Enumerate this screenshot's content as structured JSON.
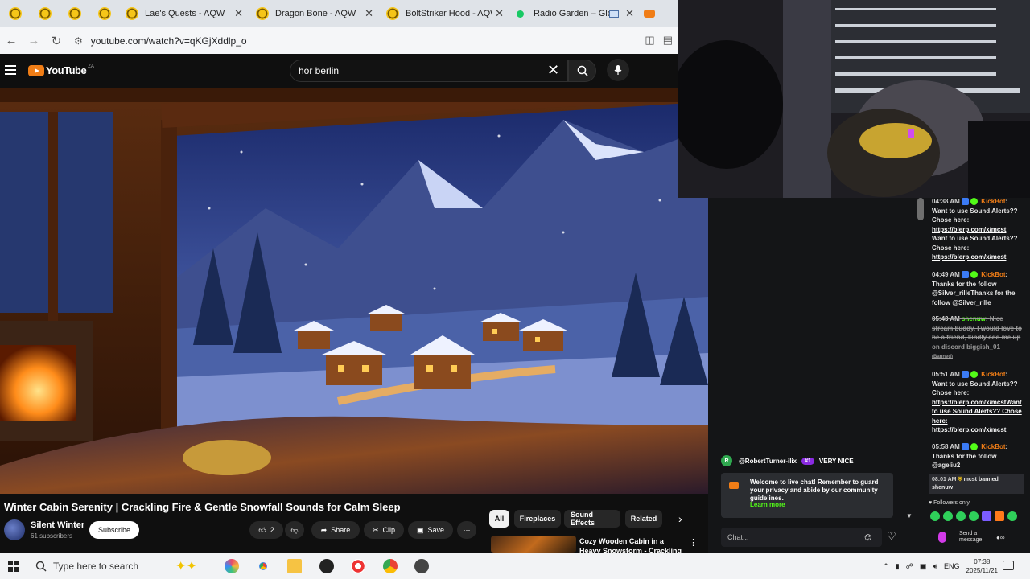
{
  "browser": {
    "tabs": [
      {
        "label": "",
        "icon": "aqw-favicon"
      },
      {
        "label": "",
        "icon": "aqw-favicon"
      },
      {
        "label": "",
        "icon": "aqw-favicon"
      },
      {
        "label": "",
        "icon": "aqw-favicon"
      },
      {
        "label": "Lae's Quests - AQW",
        "icon": "aqw-favicon"
      },
      {
        "label": "Dragon Bone - AQW",
        "icon": "aqw-favicon"
      },
      {
        "label": "BoltStriker Hood - AQW",
        "icon": "aqw-favicon"
      },
      {
        "label": "Radio Garden – Glob",
        "icon": "radio-garden-favicon"
      }
    ],
    "url": "youtube.com/watch?v=qKGjXddlp_o"
  },
  "youtube": {
    "logo_text": "YouTube",
    "logo_country": "ZA",
    "search_query": "hor berlin",
    "video_title": "Winter Cabin Serenity | Crackling Fire & Gentle Snowfall Sounds for Calm Sleep",
    "channel_name": "Silent Winter",
    "subscribers": "61 subscribers",
    "subscribe_label": "Subscribe",
    "like_count": "2",
    "share_label": "Share",
    "clip_label": "Clip",
    "save_label": "Save",
    "chips": [
      "All",
      "Fireplaces",
      "Sound Effects",
      "Related"
    ],
    "related_title": "Cozy Wooden Cabin in a Heavy Snowstorm - Crackling"
  },
  "kick": {
    "message_user": "@RobertTurner-ilix",
    "message_badge": "#1",
    "message_text": "VERY NICE",
    "welcome_text": "Welcome to live chat! Remember to guard your privacy and abide by our community guidelines.",
    "learn_more": "Learn more",
    "chat_placeholder": "Chat..."
  },
  "chat": {
    "messages": [
      {
        "time": "04:38 AM",
        "user": "KickBot",
        "text": "Want to use Sound Alerts?? Chose here:",
        "link": "https://blerp.com/x/mcst",
        "text2": "Want to use Sound Alerts?? Chose here:",
        "link2": "https://blerp.com/x/mcst"
      },
      {
        "time": "04:49 AM",
        "user": "KickBot",
        "text": "Thanks for the follow @Silver_rilleThanks for the follow @Silver_rille"
      },
      {
        "time": "05:43 AM",
        "user": "shenuw",
        "text": "Nice stream buddy, I would love to be a friend, kindly add me up on discord biggish_01",
        "banned": "(Banned)"
      },
      {
        "time": "05:51 AM",
        "user": "KickBot",
        "text": "Want to use Sound Alerts?? Chose here:",
        "link": "https://blerp.com/x/mcstWant to use Sound Alerts?? Chose here:",
        "link2": "https://blerp.com/x/mcst"
      },
      {
        "time": "05:58 AM",
        "user": "KickBot",
        "text": "Thanks for the follow @ageliu2"
      },
      {
        "time": "08:01 AM",
        "user": "mcst",
        "text": "banned shenuw"
      }
    ],
    "followers_only": "Followers only",
    "send_placeholder": "Send a message"
  },
  "taskbar": {
    "search_placeholder": "Type here to search",
    "language": "ENG",
    "time": "07:38",
    "date": "2025/11/21"
  }
}
